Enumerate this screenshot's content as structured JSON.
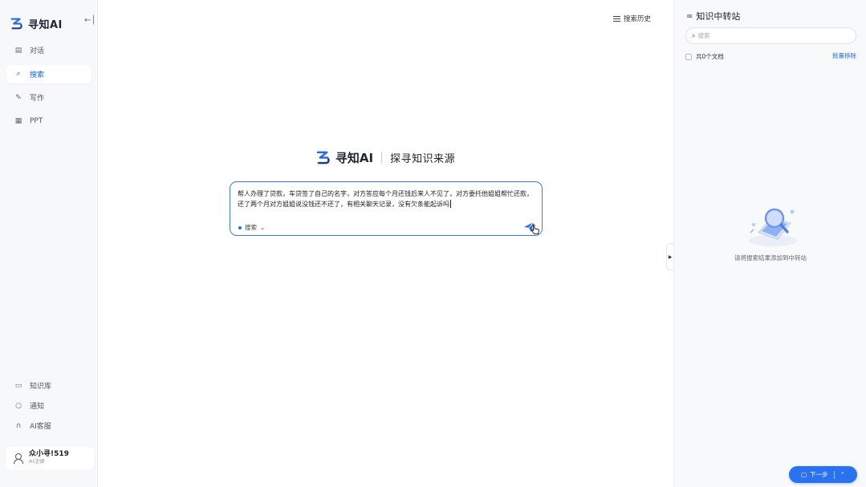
{
  "app": {
    "name": "寻知AI",
    "collapse_icon": "collapse-left-icon"
  },
  "sidebar": {
    "nav": [
      {
        "label": "对话",
        "icon": "chat-icon",
        "active": false
      },
      {
        "label": "搜索",
        "icon": "search-icon",
        "active": true
      },
      {
        "label": "写作",
        "icon": "pen-icon",
        "active": false
      },
      {
        "label": "PPT",
        "icon": "slides-icon",
        "active": false
      }
    ],
    "bottom": [
      {
        "label": "知识库",
        "icon": "folder-icon"
      },
      {
        "label": "通知",
        "icon": "bell-icon"
      },
      {
        "label": "AI客服",
        "icon": "headset-icon"
      }
    ],
    "user": {
      "name": "众小寻!519",
      "role": "AI法律"
    }
  },
  "main": {
    "history_label": "搜索历史",
    "brand": "寻知AI",
    "slogan": "探寻知识来源",
    "query": "帮人办理了贷款，车贷签了自己的名字，对方答应每个月还钱后来人不见了，对方委托他姐姐帮忙还款，还了两个月对方姐姐说没钱还不还了，有相关聊天记录，没有欠条能起诉吗",
    "mode_label": "搜索",
    "send_icon": "send-icon"
  },
  "right_panel": {
    "title": "知识中转站",
    "search_placeholder": "搜索",
    "count_label": "共0个文档",
    "batch_remove_label": "批量移除",
    "empty_text": "请将搜索结果添加到中转站",
    "next_button_label": "下一步"
  },
  "colors": {
    "accent": "#2b6be0",
    "sidebar_bg": "#f7f8fa",
    "panel_bg": "#f8f9fb"
  }
}
